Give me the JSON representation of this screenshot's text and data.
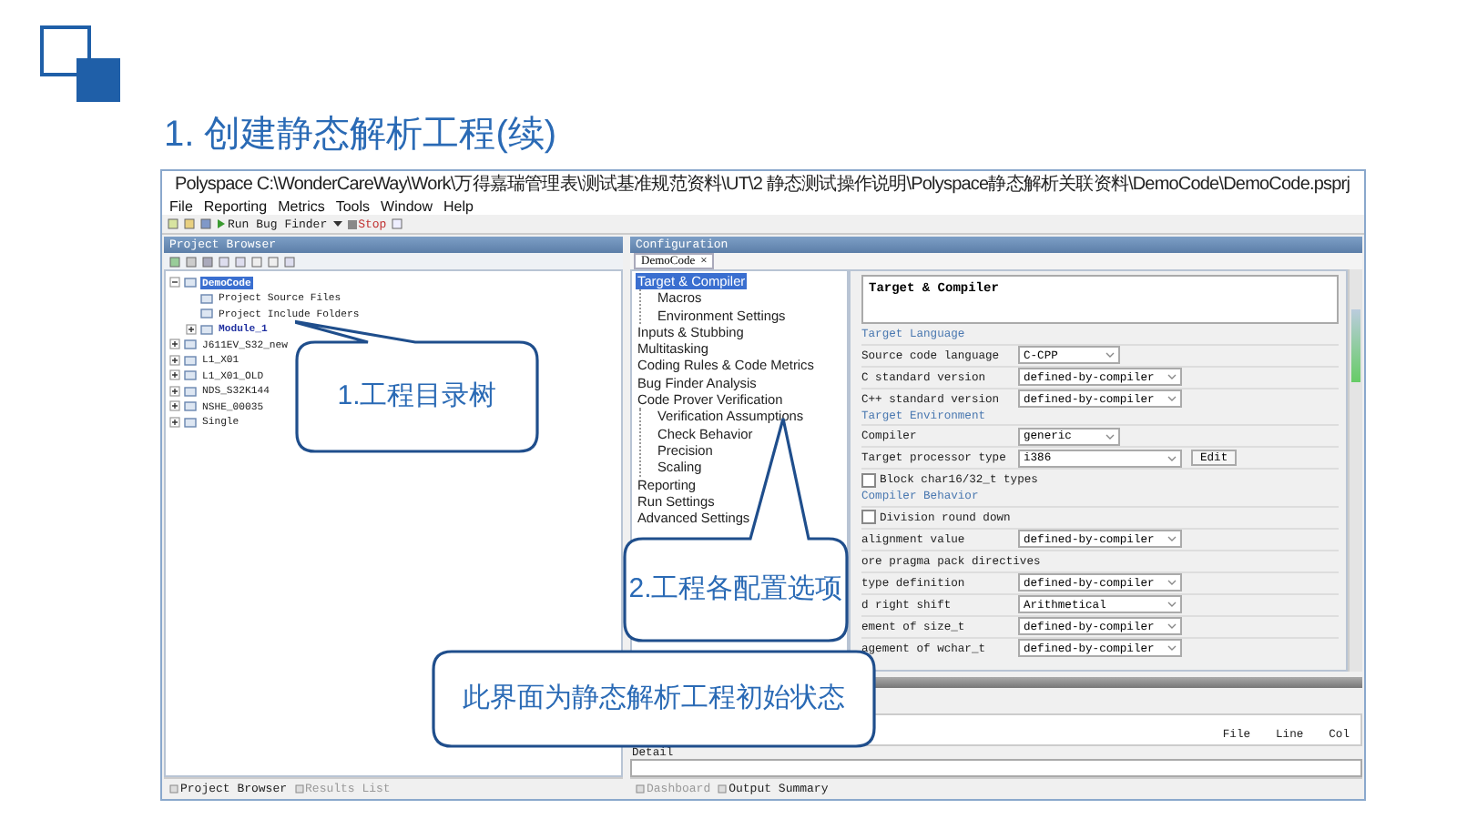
{
  "slide": {
    "title": "1. 创建静态解析工程(续)"
  },
  "window": {
    "title": "Polyspace C:\\WonderCareWay\\Work\\万得嘉瑞管理表\\测试基准规范资料\\UT\\2 静态测试操作说明\\Polyspace静态解析关联资料\\DemoCode\\DemoCode.psprj"
  },
  "menu": [
    "File",
    "Reporting",
    "Metrics",
    "Tools",
    "Window",
    "Help"
  ],
  "toolbar": {
    "run_button": "Run Bug Finder",
    "stop_button": "Stop"
  },
  "project_browser": {
    "title": "Project Browser",
    "tree": [
      {
        "label": "DemoCode",
        "selected": true,
        "expanded": true,
        "children": [
          {
            "label": "Project Source Files",
            "active": false
          },
          {
            "label": "Project Include Folders",
            "active": false
          },
          {
            "label": "Module_1",
            "active": true,
            "expanded": false
          }
        ]
      },
      {
        "label": "J611EV_S32_new",
        "selected": false,
        "expanded": false
      },
      {
        "label": "L1_X01",
        "selected": false,
        "expanded": false
      },
      {
        "label": "L1_X01_OLD",
        "selected": false,
        "expanded": false
      },
      {
        "label": "NDS_S32K144",
        "selected": false,
        "expanded": false
      },
      {
        "label": "NSHE_00035",
        "selected": false,
        "expanded": false
      },
      {
        "label": "Single",
        "selected": false,
        "expanded": false
      }
    ],
    "tabs": [
      {
        "label": "Project Browser",
        "selected": true
      },
      {
        "label": "Results List",
        "selected": false
      }
    ]
  },
  "configuration": {
    "title": "Configuration",
    "tab": {
      "label": "DemoCode",
      "close": "×"
    },
    "tree": [
      {
        "label": "Target & Compiler",
        "selected": true,
        "children": [
          {
            "label": "Macros",
            "selected": false
          },
          {
            "label": "Environment Settings",
            "selected": false
          }
        ]
      },
      {
        "label": "Inputs & Stubbing",
        "selected": false
      },
      {
        "label": "Multitasking",
        "selected": false
      },
      {
        "label": "Coding Rules & Code Metrics",
        "selected": false
      },
      {
        "label": "Bug Finder Analysis",
        "selected": false
      },
      {
        "label": "Code Prover Verification",
        "selected": false,
        "children": [
          {
            "label": "Verification Assumptions",
            "selected": false
          },
          {
            "label": "Check Behavior",
            "selected": false
          },
          {
            "label": "Precision",
            "selected": false
          },
          {
            "label": "Scaling",
            "selected": false
          }
        ]
      },
      {
        "label": "Reporting",
        "selected": false
      },
      {
        "label": "Run Settings",
        "selected": false
      },
      {
        "label": "Advanced Settings",
        "selected": false
      }
    ],
    "heading": "Target & Compiler",
    "sections": [
      {
        "title": "Target Language",
        "rows": [
          {
            "kind": "select",
            "label": "Source code language",
            "value": "C-CPP"
          },
          {
            "kind": "select",
            "label": "C standard version",
            "value": "defined-by-compiler"
          },
          {
            "kind": "select",
            "label": "C++ standard version",
            "value": "defined-by-compiler"
          }
        ]
      },
      {
        "title": "Target Environment",
        "rows": [
          {
            "kind": "select",
            "label": "Compiler",
            "value": "generic"
          },
          {
            "kind": "select_button",
            "label": "Target processor type",
            "value": "i386",
            "button": "Edit"
          },
          {
            "kind": "checkbox",
            "label": "Block char16/32_t types",
            "checked": false
          }
        ]
      },
      {
        "title": "Compiler Behavior",
        "rows": [
          {
            "kind": "checkbox",
            "label": "Division round down",
            "checked": false
          },
          {
            "kind": "select",
            "label": "alignment value",
            "value": "defined-by-compiler"
          },
          {
            "kind": "text",
            "label": "ore pragma pack directives"
          },
          {
            "kind": "select",
            "label": "type definition",
            "value": "defined-by-compiler"
          },
          {
            "kind": "select",
            "label": "d right shift",
            "value": "Arithmetical"
          },
          {
            "kind": "select",
            "label": "ement of size_t",
            "value": "defined-by-compiler"
          },
          {
            "kind": "select",
            "label": "agement of wchar_t",
            "value": "defined-by-compiler"
          }
        ]
      }
    ]
  },
  "results": {
    "columns": [
      "File",
      "Line",
      "Col"
    ],
    "detail_label": "Detail",
    "tabs": [
      {
        "label": "Dashboard",
        "selected": false
      },
      {
        "label": "Output Summary",
        "selected": true
      }
    ]
  },
  "callouts": [
    {
      "text": "1.工程目录树"
    },
    {
      "text": "2.工程各配置选项"
    },
    {
      "text": "此界面为静态解析工程初始状态"
    }
  ]
}
